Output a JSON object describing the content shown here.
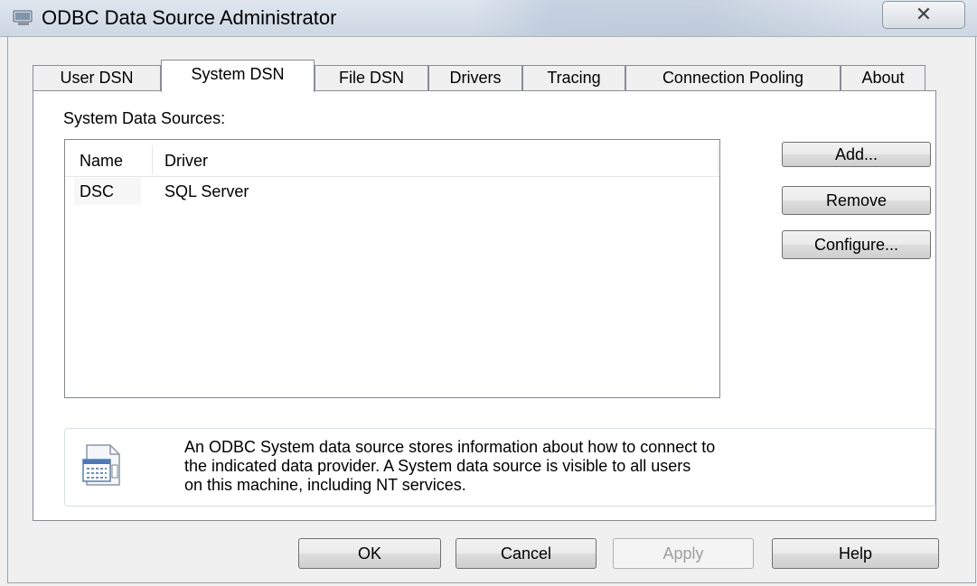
{
  "window": {
    "title": "ODBC Data Source Administrator",
    "icon": "odbc-admin-icon",
    "close_symbol": "✕"
  },
  "tabs": [
    {
      "label": "User DSN",
      "active": false
    },
    {
      "label": "System DSN",
      "active": true
    },
    {
      "label": "File DSN",
      "active": false
    },
    {
      "label": "Drivers",
      "active": false
    },
    {
      "label": "Tracing",
      "active": false
    },
    {
      "label": "Connection Pooling",
      "active": false
    },
    {
      "label": "About",
      "active": false
    }
  ],
  "panel": {
    "group_label": "System Data Sources:",
    "columns": [
      "Name",
      "Driver"
    ],
    "rows": [
      {
        "name": "DSC",
        "driver": "SQL Server"
      }
    ],
    "buttons": {
      "add": "Add...",
      "remove": "Remove",
      "configure": "Configure..."
    },
    "info_lines": [
      "An ODBC System data source stores information about how to connect to",
      "the indicated data provider.   A System data source is visible to all users",
      "on this machine, including NT services."
    ]
  },
  "footer": {
    "ok": "OK",
    "cancel": "Cancel",
    "apply": "Apply",
    "help": "Help",
    "apply_enabled": false
  },
  "colors": {
    "panel_bg": "#ffffff",
    "dialog_bg": "#f0f0f0",
    "title_bar": "#dfe6ee",
    "disabled_text": "#a0a0a0"
  }
}
